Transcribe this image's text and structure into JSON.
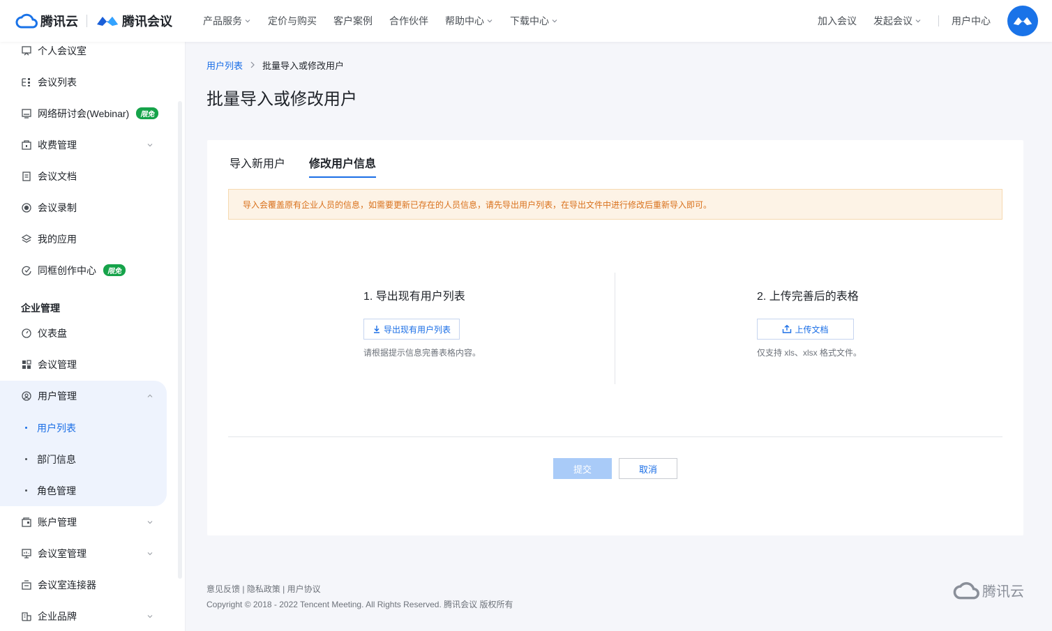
{
  "header": {
    "logo_cloud": "腾讯云",
    "logo_meeting": "腾讯会议",
    "nav": [
      {
        "label": "产品服务",
        "dropdown": true
      },
      {
        "label": "定价与购买",
        "dropdown": false
      },
      {
        "label": "客户案例",
        "dropdown": false
      },
      {
        "label": "合作伙伴",
        "dropdown": false
      },
      {
        "label": "帮助中心",
        "dropdown": true
      },
      {
        "label": "下载中心",
        "dropdown": true
      }
    ],
    "join_meeting": "加入会议",
    "start_meeting": "发起会议",
    "user_center": "用户中心"
  },
  "sidebar": {
    "items": [
      {
        "label": "个人会议室",
        "icon": "meeting-room-icon"
      },
      {
        "label": "会议列表",
        "icon": "list-icon"
      },
      {
        "label": "网络研讨会(Webinar)",
        "icon": "webinar-icon",
        "badge": "限免"
      },
      {
        "label": "收费管理",
        "icon": "billing-icon",
        "expandable": true
      },
      {
        "label": "会议文档",
        "icon": "document-icon"
      },
      {
        "label": "会议录制",
        "icon": "record-icon"
      },
      {
        "label": "我的应用",
        "icon": "apps-icon"
      },
      {
        "label": "同框创作中心",
        "icon": "creation-icon",
        "badge": "限免"
      }
    ],
    "section_title": "企业管理",
    "enterprise_items": [
      {
        "label": "仪表盘",
        "icon": "dashboard-icon"
      },
      {
        "label": "会议管理",
        "icon": "grid-icon"
      },
      {
        "label": "用户管理",
        "icon": "user-manage-icon",
        "expanded": true
      }
    ],
    "user_sub": [
      {
        "label": "用户列表",
        "active": true
      },
      {
        "label": "部门信息",
        "active": false
      },
      {
        "label": "角色管理",
        "active": false
      }
    ],
    "bottom_items": [
      {
        "label": "账户管理",
        "icon": "account-icon",
        "expandable": true
      },
      {
        "label": "会议室管理",
        "icon": "room-manage-icon",
        "expandable": true
      },
      {
        "label": "会议室连接器",
        "icon": "connector-icon"
      },
      {
        "label": "企业品牌",
        "icon": "brand-icon",
        "expandable": true
      }
    ]
  },
  "main": {
    "breadcrumb": {
      "parent": "用户列表",
      "current": "批量导入或修改用户"
    },
    "title": "批量导入或修改用户",
    "tabs": [
      "导入新用户",
      "修改用户信息"
    ],
    "active_tab": 1,
    "notice": "导入会覆盖原有企业人员的信息，如需要更新已存在的人员信息，请先导出用户列表，在导出文件中进行修改后重新导入即可。",
    "step1": {
      "title": "1. 导出现有用户列表",
      "button": "导出现有用户列表",
      "hint": "请根据提示信息完善表格内容。"
    },
    "step2": {
      "title": "2. 上传完善后的表格",
      "button": "上传文档",
      "hint": "仅支持 xls、xlsx 格式文件。"
    },
    "submit": "提交",
    "cancel": "取消"
  },
  "footer": {
    "feedback": "意见反馈",
    "privacy": "隐私政策",
    "agreement": "用户协议",
    "copyright": "Copyright © 2018 - 2022 Tencent Meeting. All Rights Reserved. 腾讯会议 版权所有",
    "logo": "腾讯云"
  },
  "colors": {
    "accent": "#1a6ee6",
    "notice_bg": "#fdf3e6",
    "notice_text": "#d9711c",
    "badge": "#16a34a"
  }
}
